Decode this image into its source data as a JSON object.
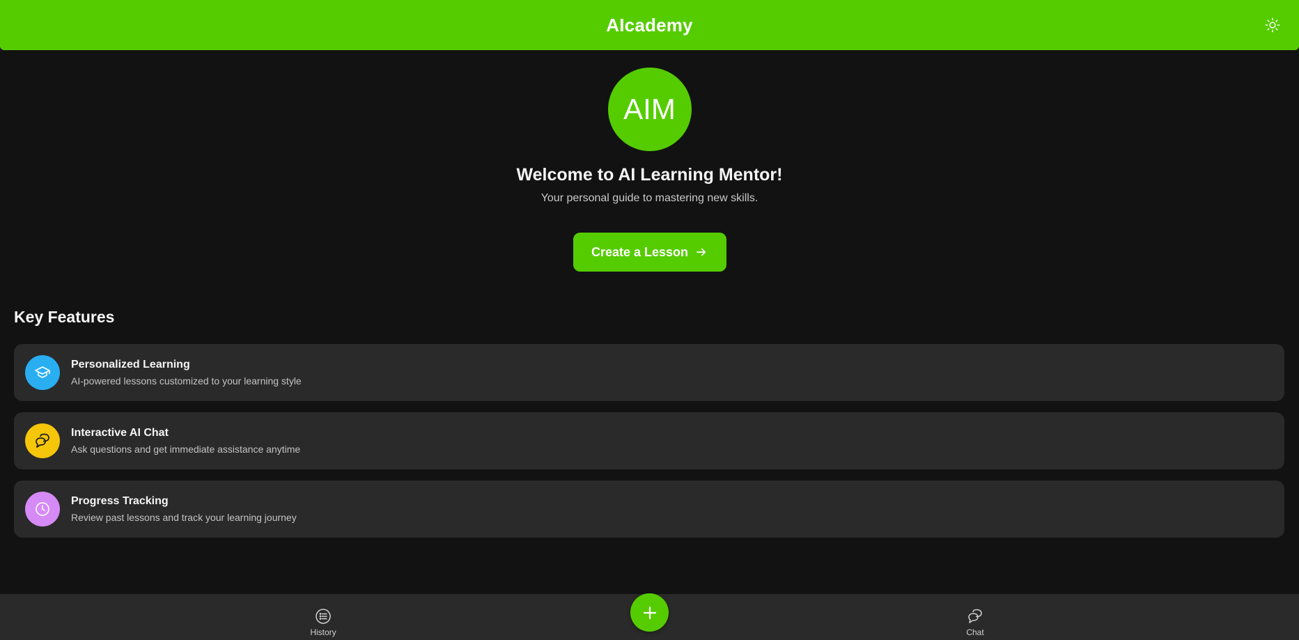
{
  "header": {
    "title": "AIcademy",
    "theme_toggle_icon": "sun-icon"
  },
  "hero": {
    "avatar_text": "AIM",
    "title": "Welcome to AI Learning Mentor!",
    "subtitle": "Your personal guide to mastering new skills.",
    "cta_label": "Create a Lesson",
    "cta_icon": "arrow-right-icon"
  },
  "features": {
    "heading": "Key Features",
    "items": [
      {
        "title": "Personalized Learning",
        "description": "AI-powered lessons customized to your learning style",
        "icon": "graduation-cap-icon",
        "color": "#29aef2"
      },
      {
        "title": "Interactive AI Chat",
        "description": "Ask questions and get immediate assistance anytime",
        "icon": "chat-bubbles-icon",
        "color": "#f5c60a"
      },
      {
        "title": "Progress Tracking",
        "description": "Review past lessons and track your learning journey",
        "icon": "clock-icon",
        "color": "#d58af5"
      }
    ]
  },
  "bottom_nav": {
    "history_label": "History",
    "history_icon": "list-icon",
    "add_icon": "plus-icon",
    "chat_label": "Chat",
    "chat_icon": "chat-bubbles-icon"
  },
  "colors": {
    "accent": "#55cc00",
    "background": "#121212",
    "card": "#2a2a2a"
  }
}
